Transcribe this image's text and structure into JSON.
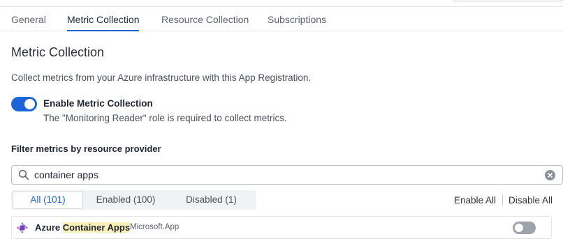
{
  "tabs": [
    {
      "label": "General",
      "active": false
    },
    {
      "label": "Metric Collection",
      "active": true
    },
    {
      "label": "Resource Collection",
      "active": false
    },
    {
      "label": "Subscriptions",
      "active": false
    }
  ],
  "section": {
    "title": "Metric Collection",
    "description": "Collect metrics from your Azure infrastructure with this App Registration."
  },
  "enable_metric_collection": {
    "label": "Enable Metric Collection",
    "description": "The \"Monitoring Reader\" role is required to collect metrics.",
    "enabled": true
  },
  "filter": {
    "title": "Filter metrics by resource provider",
    "search_value": "container apps",
    "search_icon": "search-icon",
    "clear_icon": "clear-icon"
  },
  "segments": [
    {
      "label": "All (101)",
      "active": true
    },
    {
      "label": "Enabled (100)",
      "active": false
    },
    {
      "label": "Disabled (1)",
      "active": false
    }
  ],
  "actions": {
    "enable_all": "Enable All",
    "disable_all": "Disable All"
  },
  "results": [
    {
      "name_prefix": "Azure ",
      "name_highlight_1": "Container",
      "name_space": " ",
      "name_highlight_2": "Apps",
      "namespace": "Microsoft.App",
      "icon": "azure-container-apps-icon",
      "enabled": false
    }
  ],
  "colors": {
    "accent": "#1a66d9",
    "highlight": "#fbf0b8",
    "toggle_off": "#9ea3ab"
  }
}
